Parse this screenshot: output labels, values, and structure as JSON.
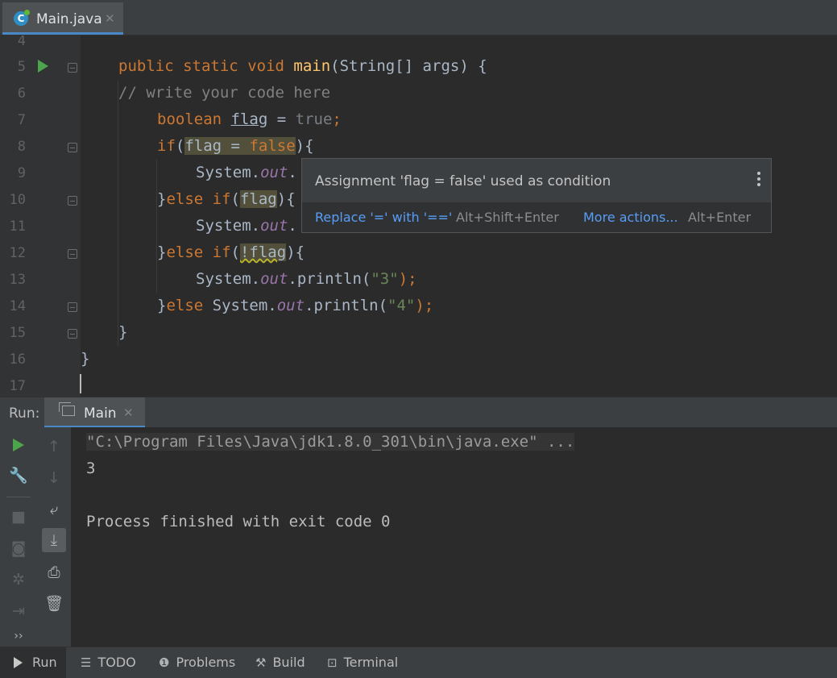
{
  "tab": {
    "filename": "Main.java",
    "close": "✕"
  },
  "editor": {
    "line_numbers": [
      "4",
      "5",
      "6",
      "7",
      "8",
      "9",
      "10",
      "11",
      "12",
      "13",
      "14",
      "15",
      "16",
      "17"
    ],
    "code": {
      "l5_kw1": "public",
      "l5_kw2": "static",
      "l5_kw3": "void",
      "l5_fn": "main",
      "l5_rest": "(String[] args) {",
      "l6_comment": "// write your code here",
      "l7_type": "boolean",
      "l7_var": "flag",
      "l7_eq": " = ",
      "l7_val": "true",
      "l7_semi": ";",
      "l8_if": "if",
      "l8_open": "(",
      "l8_flag": "flag",
      "l8_eq": " = ",
      "l8_false": "false",
      "l8_close": "){",
      "l9_sys": "System.",
      "l9_out": "out",
      "l9_dot": ".",
      "l10_brace": "}",
      "l10_else": "else if",
      "l10_open": "(",
      "l10_flag": "flag",
      "l10_close": "){",
      "l11_sys": "System.",
      "l11_out": "out",
      "l11_dot": ".",
      "l12_brace": "}",
      "l12_else": "else if",
      "l12_open": "(",
      "l12_not": "!flag",
      "l12_close": "){",
      "l13_sys": "System.",
      "l13_out": "out",
      "l13_println": ".println(",
      "l13_str": "\"3\"",
      "l13_end": ");",
      "l14_brace": "}",
      "l14_else": "else",
      "l14_sys": " System.",
      "l14_out": "out",
      "l14_println": ".println(",
      "l14_str": "\"4\"",
      "l14_end": ");",
      "l15": "}",
      "l16": "}"
    }
  },
  "popup": {
    "message": "Assignment 'flag = false' used as condition",
    "action1": "Replace '=' with '=='",
    "shortcut1": "Alt+Shift+Enter",
    "action2": "More actions...",
    "shortcut2": "Alt+Enter"
  },
  "run_panel": {
    "label": "Run:",
    "tab": "Main",
    "close": "✕",
    "console": [
      "\"C:\\Program Files\\Java\\jdk1.8.0_301\\bin\\java.exe\" ...",
      "3",
      "Process finished with exit code 0"
    ]
  },
  "bottom_bar": {
    "run": "Run",
    "todo": "TODO",
    "problems": "Problems",
    "build": "Build",
    "terminal": "Terminal"
  },
  "colors": {
    "keyword": "#cc7832",
    "function": "#ffc66d",
    "comment": "#808080",
    "string": "#6a8759",
    "static_field": "#9876aa",
    "accent": "#4a88c7",
    "run_green": "#4ca54c"
  }
}
